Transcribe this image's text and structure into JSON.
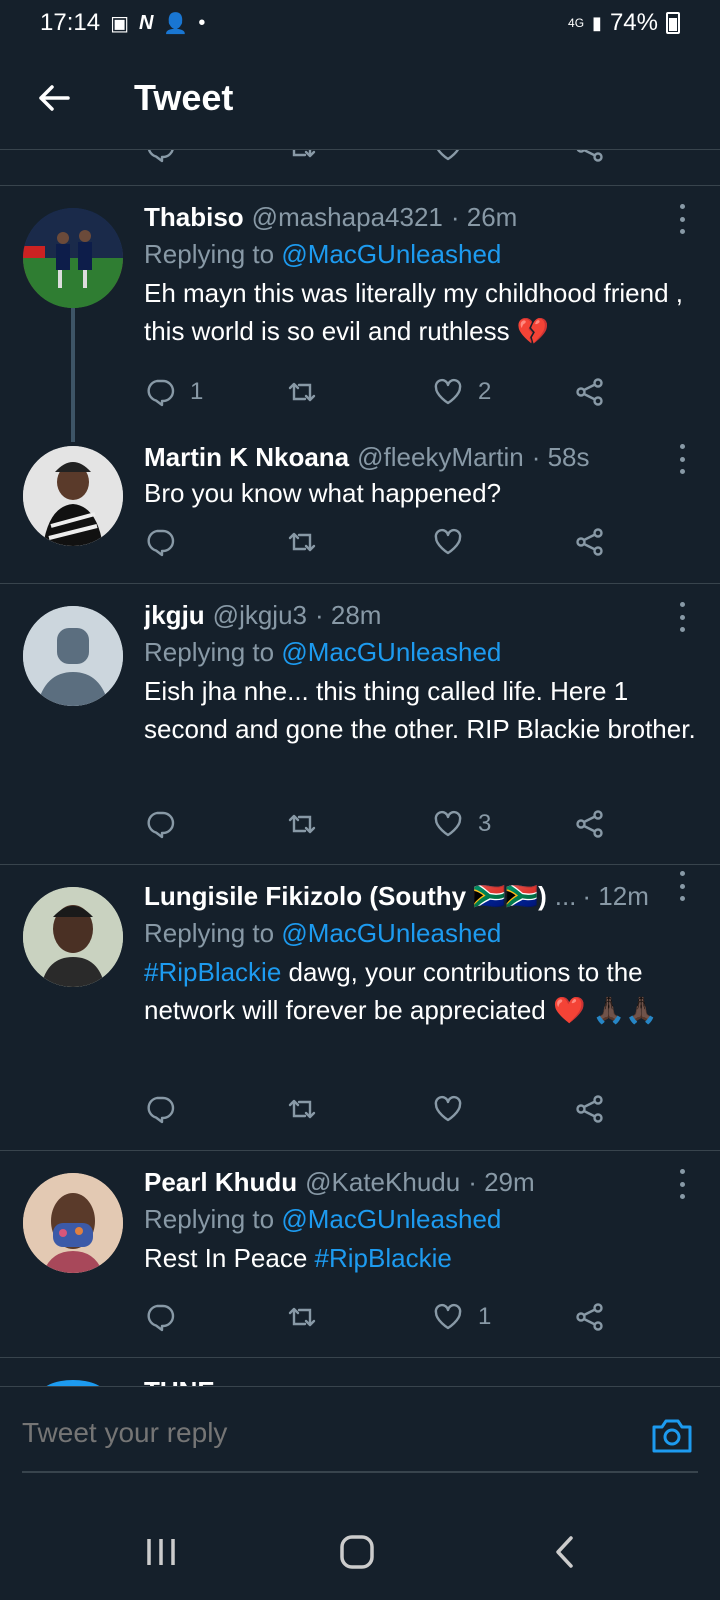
{
  "status_bar": {
    "time": "17:14",
    "network": "4G",
    "battery": "74%"
  },
  "header": {
    "title": "Tweet"
  },
  "tweets": [
    {
      "name": "Thabiso",
      "handle": "@mashapa4321",
      "time": "· 26m",
      "replying_prefix": "Replying to ",
      "replying_to": "@MacGUnleashed",
      "text": "Eh mayn this was literally my childhood friend , this world is so evil and ruthless 💔",
      "replies": "1",
      "retweets": "",
      "likes": "2"
    },
    {
      "name": "Martin K Nkoana",
      "handle": "@fleekyMartin",
      "time": "· 58s",
      "text": "Bro you know what happened?",
      "replies": "",
      "retweets": "",
      "likes": ""
    },
    {
      "name": "jkgju",
      "handle": "@jkgju3",
      "time": "· 28m",
      "replying_prefix": "Replying to ",
      "replying_to": "@MacGUnleashed",
      "text": "Eish jha nhe... this thing called life. Here 1 second and gone the other. RIP Blackie brother.",
      "replies": "",
      "retweets": "",
      "likes": "3"
    },
    {
      "name": "Lungisile Fikizolo (Southy 🇿🇦🇿🇦)",
      "handle": "...",
      "time": "· 12m",
      "replying_prefix": "Replying to ",
      "replying_to": "@MacGUnleashed",
      "hashtag": "#RipBlackie",
      "text": " dawg, your contributions to the network will forever be appreciated ❤️ 🙏🏿🙏🏿",
      "replies": "",
      "retweets": "",
      "likes": ""
    },
    {
      "name": "Pearl Khudu",
      "handle": "@KateKhudu",
      "time": "· 29m",
      "replying_prefix": "Replying to ",
      "replying_to": "@MacGUnleashed",
      "text_prefix": "Rest In Peace ",
      "hashtag": "#RipBlackie",
      "replies": "",
      "retweets": "",
      "likes": "1"
    }
  ],
  "partial_next": {
    "name": "TUNE"
  },
  "reply_bar": {
    "placeholder": "Tweet your reply"
  },
  "icons": {
    "back": "arrow-left-icon",
    "more": "more-vertical-icon",
    "reply": "reply-icon",
    "retweet": "retweet-icon",
    "like": "heart-icon",
    "share": "share-icon",
    "camera": "camera-icon"
  },
  "colors": {
    "background": "#15202b",
    "accent": "#1d9bf0",
    "secondary_text": "#8899a6",
    "divider": "#38444d"
  }
}
